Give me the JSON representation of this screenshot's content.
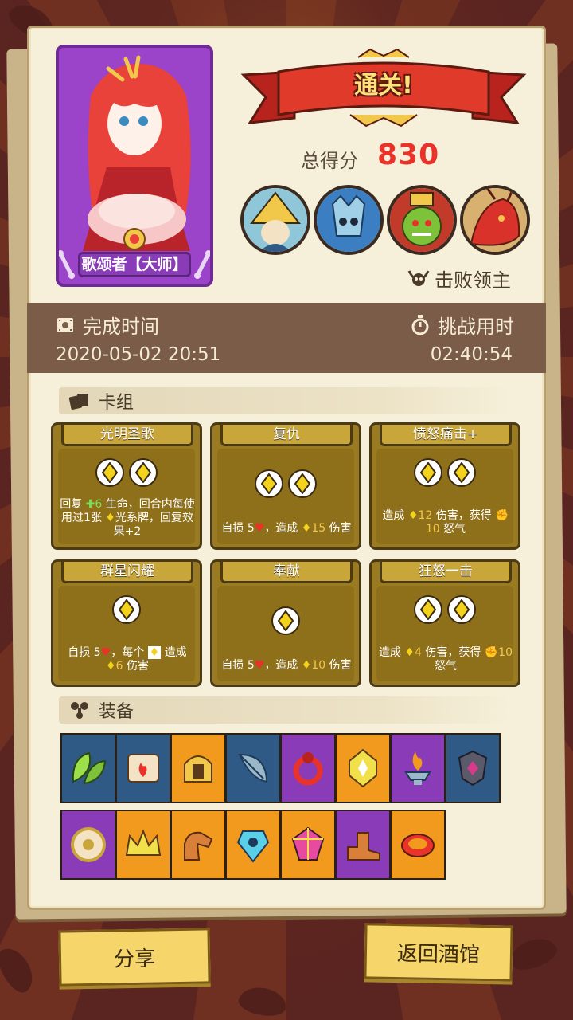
{
  "result": {
    "banner": "通关!",
    "score_label": "总得分",
    "score": "830"
  },
  "hero": {
    "name_label": "歌颂者【大师】"
  },
  "bosses": {
    "label": "击败领主",
    "items": [
      "boss-yellow-wizard",
      "boss-blue-knight",
      "boss-green-demon",
      "boss-red-dragon"
    ]
  },
  "time": {
    "finish_label": "完成时间",
    "finish_value": "2020-05-02 20:51",
    "duration_label": "挑战用时",
    "duration_value": "02:40:54"
  },
  "deck": {
    "title": "卡组",
    "cards": [
      {
        "name": "光明圣歌",
        "gems": 2,
        "desc1": "回复",
        "heal": "6",
        "desc2": "生命，回合内每使用过1张",
        "desc3": "光系牌，回复效果+2"
      },
      {
        "name": "复仇",
        "gems": 2,
        "desc": "自损 5",
        "desc_b": "，造成",
        "dmg": "15",
        "desc_c": "伤害"
      },
      {
        "name": "愤怒痛击+",
        "gems": 2,
        "desc": "造成",
        "dmg": "12",
        "desc_b": "伤害，获得",
        "rage": "10",
        "desc_c": "怒气"
      },
      {
        "name": "群星闪耀",
        "gems": 1,
        "desc": "自损 5",
        "desc_b": "，每个",
        "desc_c": "造成",
        "dmg": "6",
        "desc_d": "伤害"
      },
      {
        "name": "奉献",
        "gems": 1,
        "desc": "自损 5",
        "desc_b": "，造成",
        "dmg": "10",
        "desc_c": "伤害"
      },
      {
        "name": "狂怒一击",
        "gems": 2,
        "desc": "造成",
        "dmg": "4",
        "desc_b": "伤害，获得",
        "rage": "10",
        "desc_c": "怒气"
      }
    ]
  },
  "equipment": {
    "title": "装备",
    "row1": [
      "leaf-icon",
      "fire-scroll-icon",
      "helmet-icon",
      "feather-icon",
      "red-ring-icon",
      "yellow-gem-icon",
      "fire-bowl-icon",
      "shield-gem-icon"
    ],
    "row2": [
      "eye-shield-icon",
      "crown-icon",
      "gauntlet-icon",
      "skull-crystal-icon",
      "rainbow-crystal-icon",
      "boots-icon",
      "red-bracelet-icon"
    ]
  },
  "buttons": {
    "share": "分享",
    "back": "返回酒馆"
  },
  "colors": {
    "blue": "#2f5a86",
    "orange": "#f29a1e",
    "purple": "#8a3bb8",
    "score": "#e8322a"
  }
}
